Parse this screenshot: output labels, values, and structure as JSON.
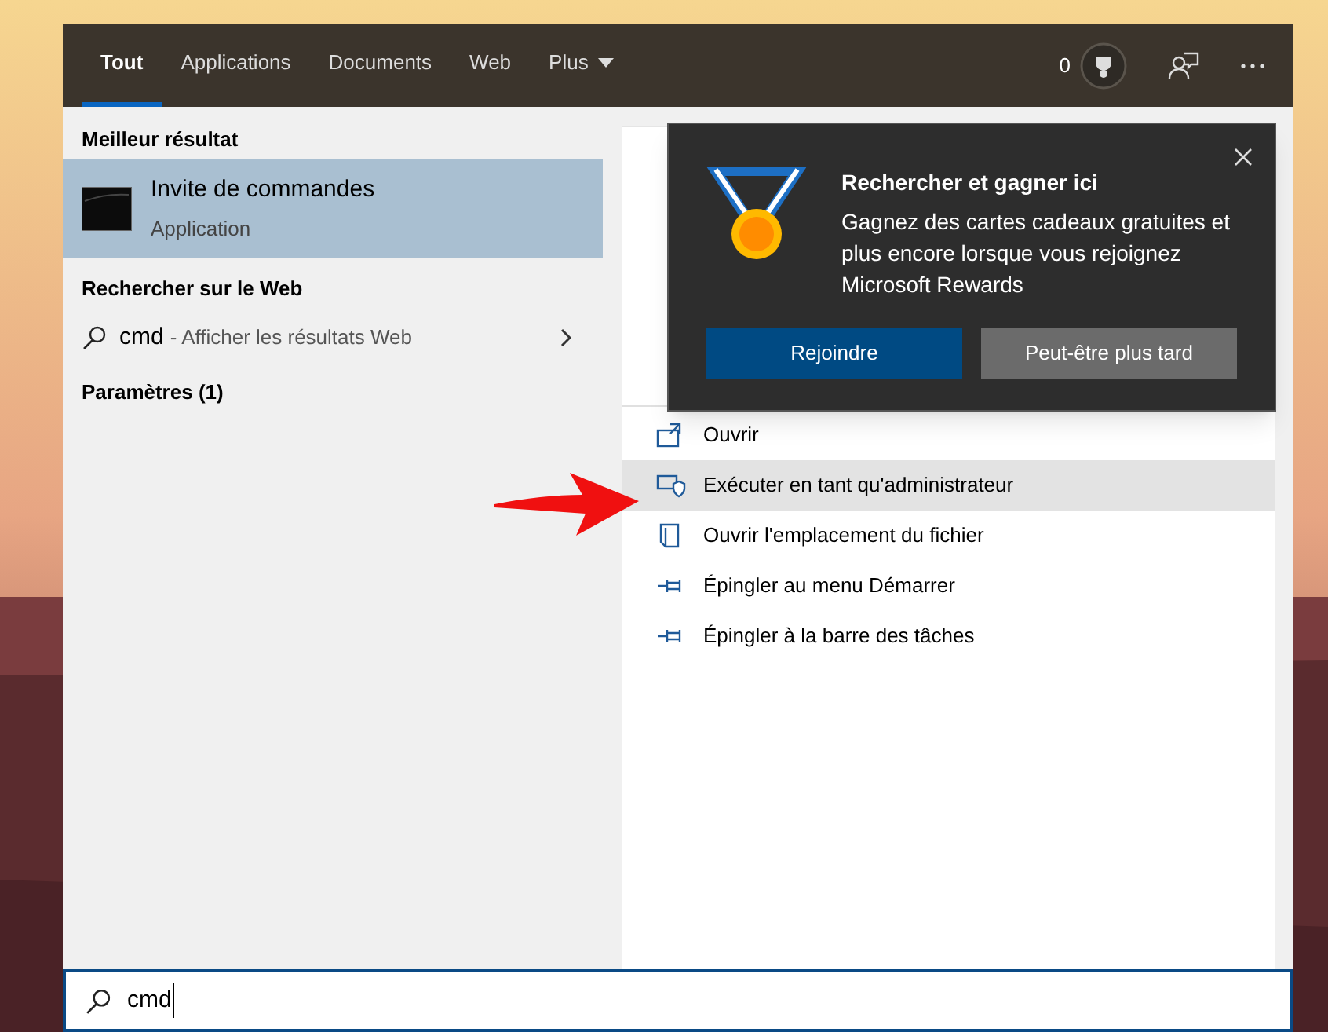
{
  "tabs": [
    {
      "label": "Tout",
      "selected": true,
      "has_menu": false
    },
    {
      "label": "Applications",
      "selected": false,
      "has_menu": false
    },
    {
      "label": "Documents",
      "selected": false,
      "has_menu": false
    },
    {
      "label": "Web",
      "selected": false,
      "has_menu": false
    },
    {
      "label": "Plus",
      "selected": false,
      "has_menu": true
    }
  ],
  "rewards_points": "0",
  "best_match": {
    "heading": "Meilleur résultat",
    "title": "Invite de commandes",
    "subtitle": "Application",
    "selected": true
  },
  "web_search": {
    "heading": "Rechercher sur le Web",
    "query": "cmd",
    "hint": "- Afficher les résultats Web"
  },
  "settings": {
    "heading": "Paramètres (1)"
  },
  "actions": [
    {
      "label": "Ouvrir",
      "kind": "open",
      "selected": false
    },
    {
      "label": "Exécuter en tant qu'administrateur",
      "kind": "admin",
      "selected": true
    },
    {
      "label": "Ouvrir l'emplacement du fichier",
      "kind": "folder",
      "selected": false
    },
    {
      "label": "Épingler au menu Démarrer",
      "kind": "pin",
      "selected": false
    },
    {
      "label": "Épingler à la barre des tâches",
      "kind": "pin",
      "selected": false
    }
  ],
  "popup": {
    "title": "Rechercher et gagner ici",
    "body": "Gagnez des cartes cadeaux gratuites et plus encore lorsque vous rejoignez Microsoft Rewards",
    "buttons": [
      {
        "label": "Rejoindre",
        "kind": "primary"
      },
      {
        "label": "Peut-être plus tard",
        "kind": "secondary"
      }
    ]
  },
  "search": {
    "value": "cmd"
  }
}
